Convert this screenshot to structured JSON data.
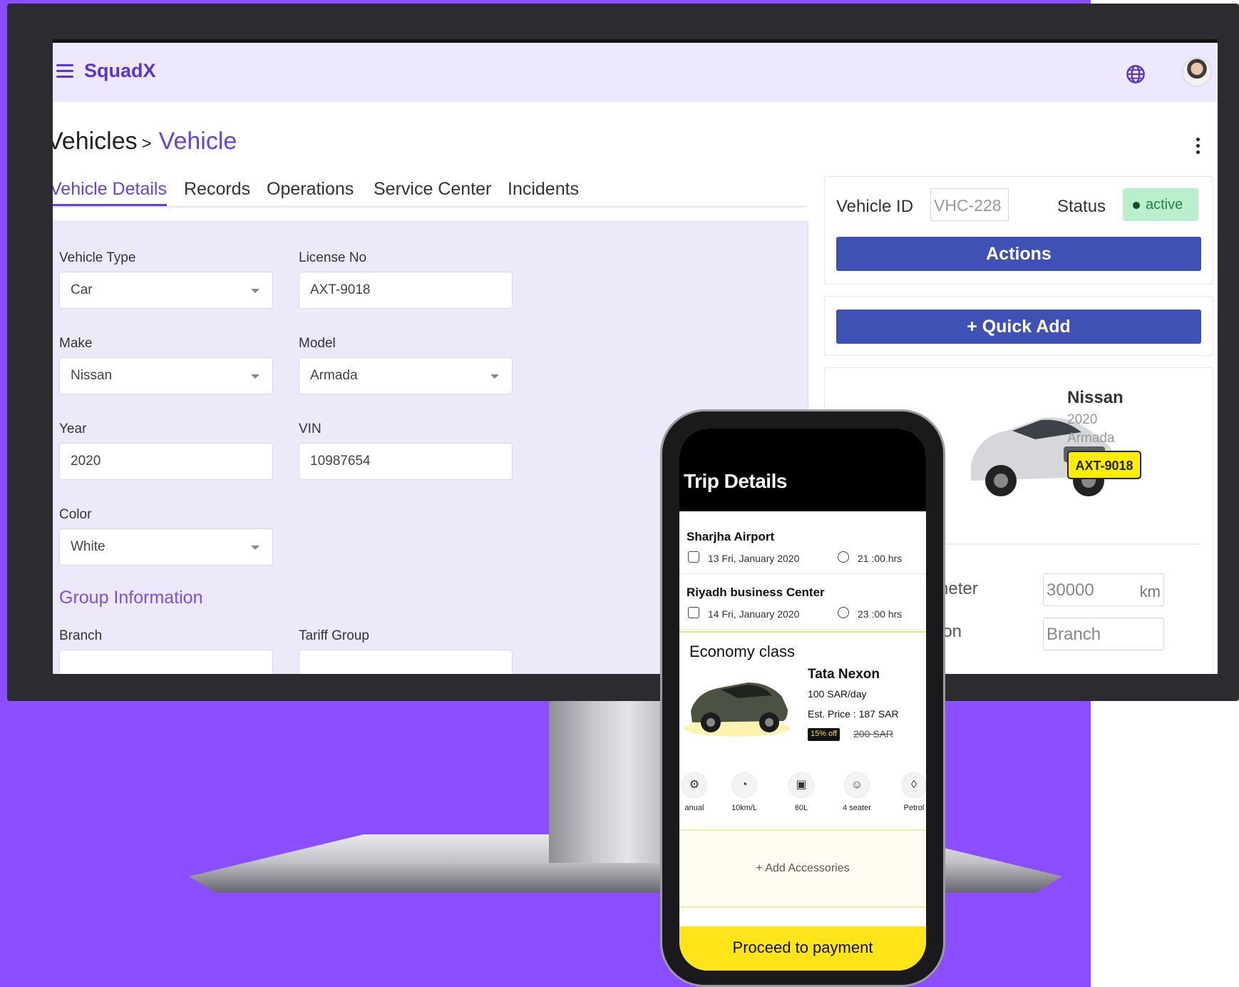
{
  "app": {
    "brand": "SquadX"
  },
  "breadcrumb": {
    "parent": "Vehicles",
    "separator": ">",
    "current": "Vehicle"
  },
  "tabs": [
    "Vehicle Details",
    "Records",
    "Operations",
    "Service Center",
    "Incidents"
  ],
  "form": {
    "vehicle_type": {
      "label": "Vehicle Type",
      "value": "Car"
    },
    "license_no": {
      "label": "License No",
      "value": "AXT-9018"
    },
    "make": {
      "label": "Make",
      "value": "Nissan"
    },
    "model": {
      "label": "Model",
      "value": "Armada"
    },
    "year": {
      "label": "Year",
      "value": "2020"
    },
    "vin": {
      "label": "VIN",
      "value": "10987654"
    },
    "color": {
      "label": "Color",
      "value": "White"
    },
    "group_title": "Group Information",
    "branch": {
      "label": "Branch"
    },
    "tariff_group": {
      "label": "Tariff Group"
    }
  },
  "side": {
    "vehicle_id_label": "Vehicle ID",
    "vehicle_id_value": "VHC-228",
    "status_label": "Status",
    "status_value": "active",
    "status_color": "#b9efcc",
    "actions_label": "Actions",
    "quick_add_label": "+ Quick Add",
    "car": {
      "make": "Nissan",
      "year": "2020",
      "model": "Armada",
      "plate": "AXT-9018"
    },
    "odometer_label_partial": "neter",
    "odometer_value": "30000",
    "odometer_unit": "km",
    "location_label_partial": "ion",
    "branch_placeholder": "Branch"
  },
  "phone": {
    "title": "Trip Details",
    "legs": [
      {
        "place": "Sharjha Airport",
        "date": "13 Fri, January 2020",
        "time": "21 :00 hrs"
      },
      {
        "place": "Riyadh business Center",
        "date": "14 Fri, January 2020",
        "time": "23 :00 hrs"
      }
    ],
    "class_title": "Economy class",
    "car_name": "Tata Nexon",
    "rate": "100 SAR/day",
    "est_price": "Est. Price : 187 SAR",
    "discount": "15% off",
    "old_price": "200 SAR",
    "features": [
      {
        "label": "anual",
        "icon": "gear-shift-icon",
        "glyph": "⚙"
      },
      {
        "label": "10km/L",
        "icon": "speedometer-icon",
        "glyph": "◔"
      },
      {
        "label": "60L",
        "icon": "fuel-tank-icon",
        "glyph": "▣"
      },
      {
        "label": "4 seater",
        "icon": "users-icon",
        "glyph": "☺"
      },
      {
        "label": "Petrol",
        "icon": "drop-icon",
        "glyph": "◊"
      }
    ],
    "add_accessories": "+ Add Accessories",
    "proceed": "Proceed to payment"
  },
  "colors": {
    "accent": "#6a3fe0",
    "button": "#3f51b5",
    "phone_cta": "#ffe41a",
    "background": "#8a4dff"
  }
}
